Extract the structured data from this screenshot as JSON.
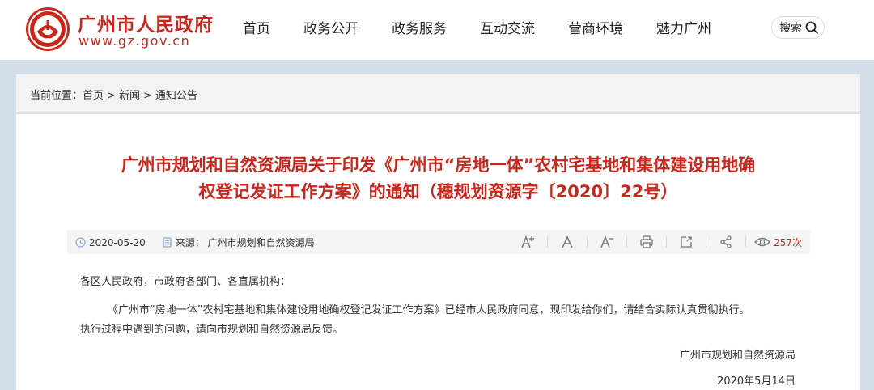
{
  "header": {
    "site_title": "广州市人民政府",
    "site_url": "www.gz.gov.cn",
    "nav": [
      "首页",
      "政务公开",
      "政务服务",
      "互动交流",
      "营商环境",
      "魅力广州"
    ],
    "search_label": "搜索"
  },
  "breadcrumb": {
    "prefix": "当前位置：",
    "items": [
      "首页",
      "新闻",
      "通知公告"
    ],
    "separator": ">"
  },
  "article": {
    "title_line1": "广州市规划和自然资源局关于印发《广州市“房地一体”农村宅基地和集体建设用地确",
    "title_line2": "权登记发证工作方案》的通知（穗规划资源字〔2020〕22号）",
    "date": "2020-05-20",
    "source": "来源：  广州市规划和自然资源局",
    "views": "257次",
    "salutation": "各区人民政府，市政府各部门、各直属机构：",
    "paragraph_line1": "《广州市“房地一体”农村宅基地和集体建设用地确权登记发证工作方案》已经市人民政府同意，现印发给你们，请结合实际认真贯彻执行。",
    "paragraph_line2": "执行过程中遇到的问题，请向市规划和自然资源局反馈。",
    "signature": "广州市规划和自然资源局",
    "sign_date": "2020年5月14日"
  },
  "colors": {
    "brand_red": "#c9271c",
    "page_bg": "#d3deeb"
  },
  "icons": {
    "logo": "gz-emblem-icon",
    "search": "search-icon",
    "date": "clock-icon",
    "source": "document-icon",
    "font_increase": "font-increase-icon",
    "font_default": "font-default-icon",
    "font_decrease": "font-decrease-icon",
    "print": "print-icon",
    "share_out": "share-out-icon",
    "share": "share-icon",
    "views": "eye-icon"
  }
}
